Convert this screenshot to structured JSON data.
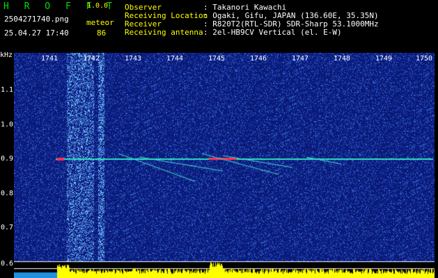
{
  "header": {
    "brand": "H R O F F T",
    "version": "1.0.0",
    "filename": "2504271740.png",
    "datetime": "25.04.27 17:40",
    "event_type": "meteor",
    "event_count": "86"
  },
  "info": [
    {
      "label": "Observer",
      "value": ": Takanori Kawachi"
    },
    {
      "label": "Receiving Location",
      "value": ": Ogaki, Gifu, JAPAN (136.60E, 35.35N)"
    },
    {
      "label": "Receiver",
      "value": ": R820T2(RTL-SDR) SDR-Sharp 53.1000MHz"
    },
    {
      "label": "Receiving antenna",
      "value": ": 2el-HB9CV Vertical (el. E-W)"
    }
  ],
  "axes": {
    "y_unit": "kHz",
    "y_ticks": [
      "1.1",
      "1.0",
      "0.9",
      "0.8",
      "0.7",
      "0.6"
    ],
    "x_ticks": [
      "1741",
      "1742",
      "1743",
      "1744",
      "1745",
      "1746",
      "1747",
      "1748",
      "1749",
      "1750"
    ]
  },
  "colors": {
    "background": "#000000",
    "spectrogram_base": "#0a1a78",
    "carrier_line": "#30e0c0",
    "level_bars": "#ffff00",
    "label_yellow": "#ffff00",
    "label_green": "#00e000"
  }
}
